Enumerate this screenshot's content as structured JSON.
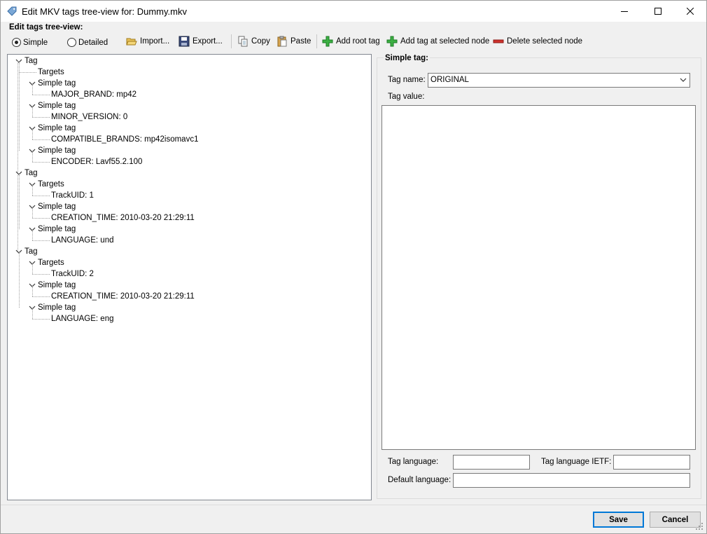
{
  "window": {
    "title": "Edit MKV tags tree-view for: Dummy.mkv"
  },
  "edit_label": "Edit tags tree-view:",
  "view_mode": {
    "simple": "Simple",
    "detailed": "Detailed",
    "selected": "simple"
  },
  "toolbar": {
    "import": "Import...",
    "export": "Export...",
    "copy": "Copy",
    "paste": "Paste",
    "add_root": "Add root tag",
    "add_at_node": "Add tag at selected node",
    "delete_node": "Delete selected node"
  },
  "tree": [
    {
      "label": "Tag",
      "children": [
        {
          "label": "Targets",
          "children": []
        },
        {
          "label": "Simple tag",
          "children": [
            {
              "label": "MAJOR_BRAND: mp42"
            }
          ]
        },
        {
          "label": "Simple tag",
          "children": [
            {
              "label": "MINOR_VERSION: 0"
            }
          ]
        },
        {
          "label": "Simple tag",
          "children": [
            {
              "label": "COMPATIBLE_BRANDS: mp42isomavc1"
            }
          ]
        },
        {
          "label": "Simple tag",
          "children": [
            {
              "label": "ENCODER: Lavf55.2.100"
            }
          ]
        }
      ]
    },
    {
      "label": "Tag",
      "children": [
        {
          "label": "Targets",
          "children": [
            {
              "label": "TrackUID: 1"
            }
          ]
        },
        {
          "label": "Simple tag",
          "children": [
            {
              "label": "CREATION_TIME: 2010-03-20 21:29:11"
            }
          ]
        },
        {
          "label": "Simple tag",
          "children": [
            {
              "label": "LANGUAGE: und"
            }
          ]
        }
      ]
    },
    {
      "label": "Tag",
      "children": [
        {
          "label": "Targets",
          "children": [
            {
              "label": "TrackUID: 2"
            }
          ]
        },
        {
          "label": "Simple tag",
          "children": [
            {
              "label": "CREATION_TIME: 2010-03-20 21:29:11"
            }
          ]
        },
        {
          "label": "Simple tag",
          "children": [
            {
              "label": "LANGUAGE: eng"
            }
          ]
        }
      ]
    }
  ],
  "simple_tag": {
    "group_title": "Simple tag:",
    "tag_name_label": "Tag name:",
    "tag_name_value": "ORIGINAL",
    "tag_value_label": "Tag value:",
    "tag_value": "",
    "tag_language_label": "Tag language:",
    "tag_language_value": "",
    "tag_language_ietf_label": "Tag language IETF:",
    "tag_language_ietf_value": "",
    "default_language_label": "Default language:",
    "default_language_value": ""
  },
  "buttons": {
    "save": "Save",
    "cancel": "Cancel"
  }
}
